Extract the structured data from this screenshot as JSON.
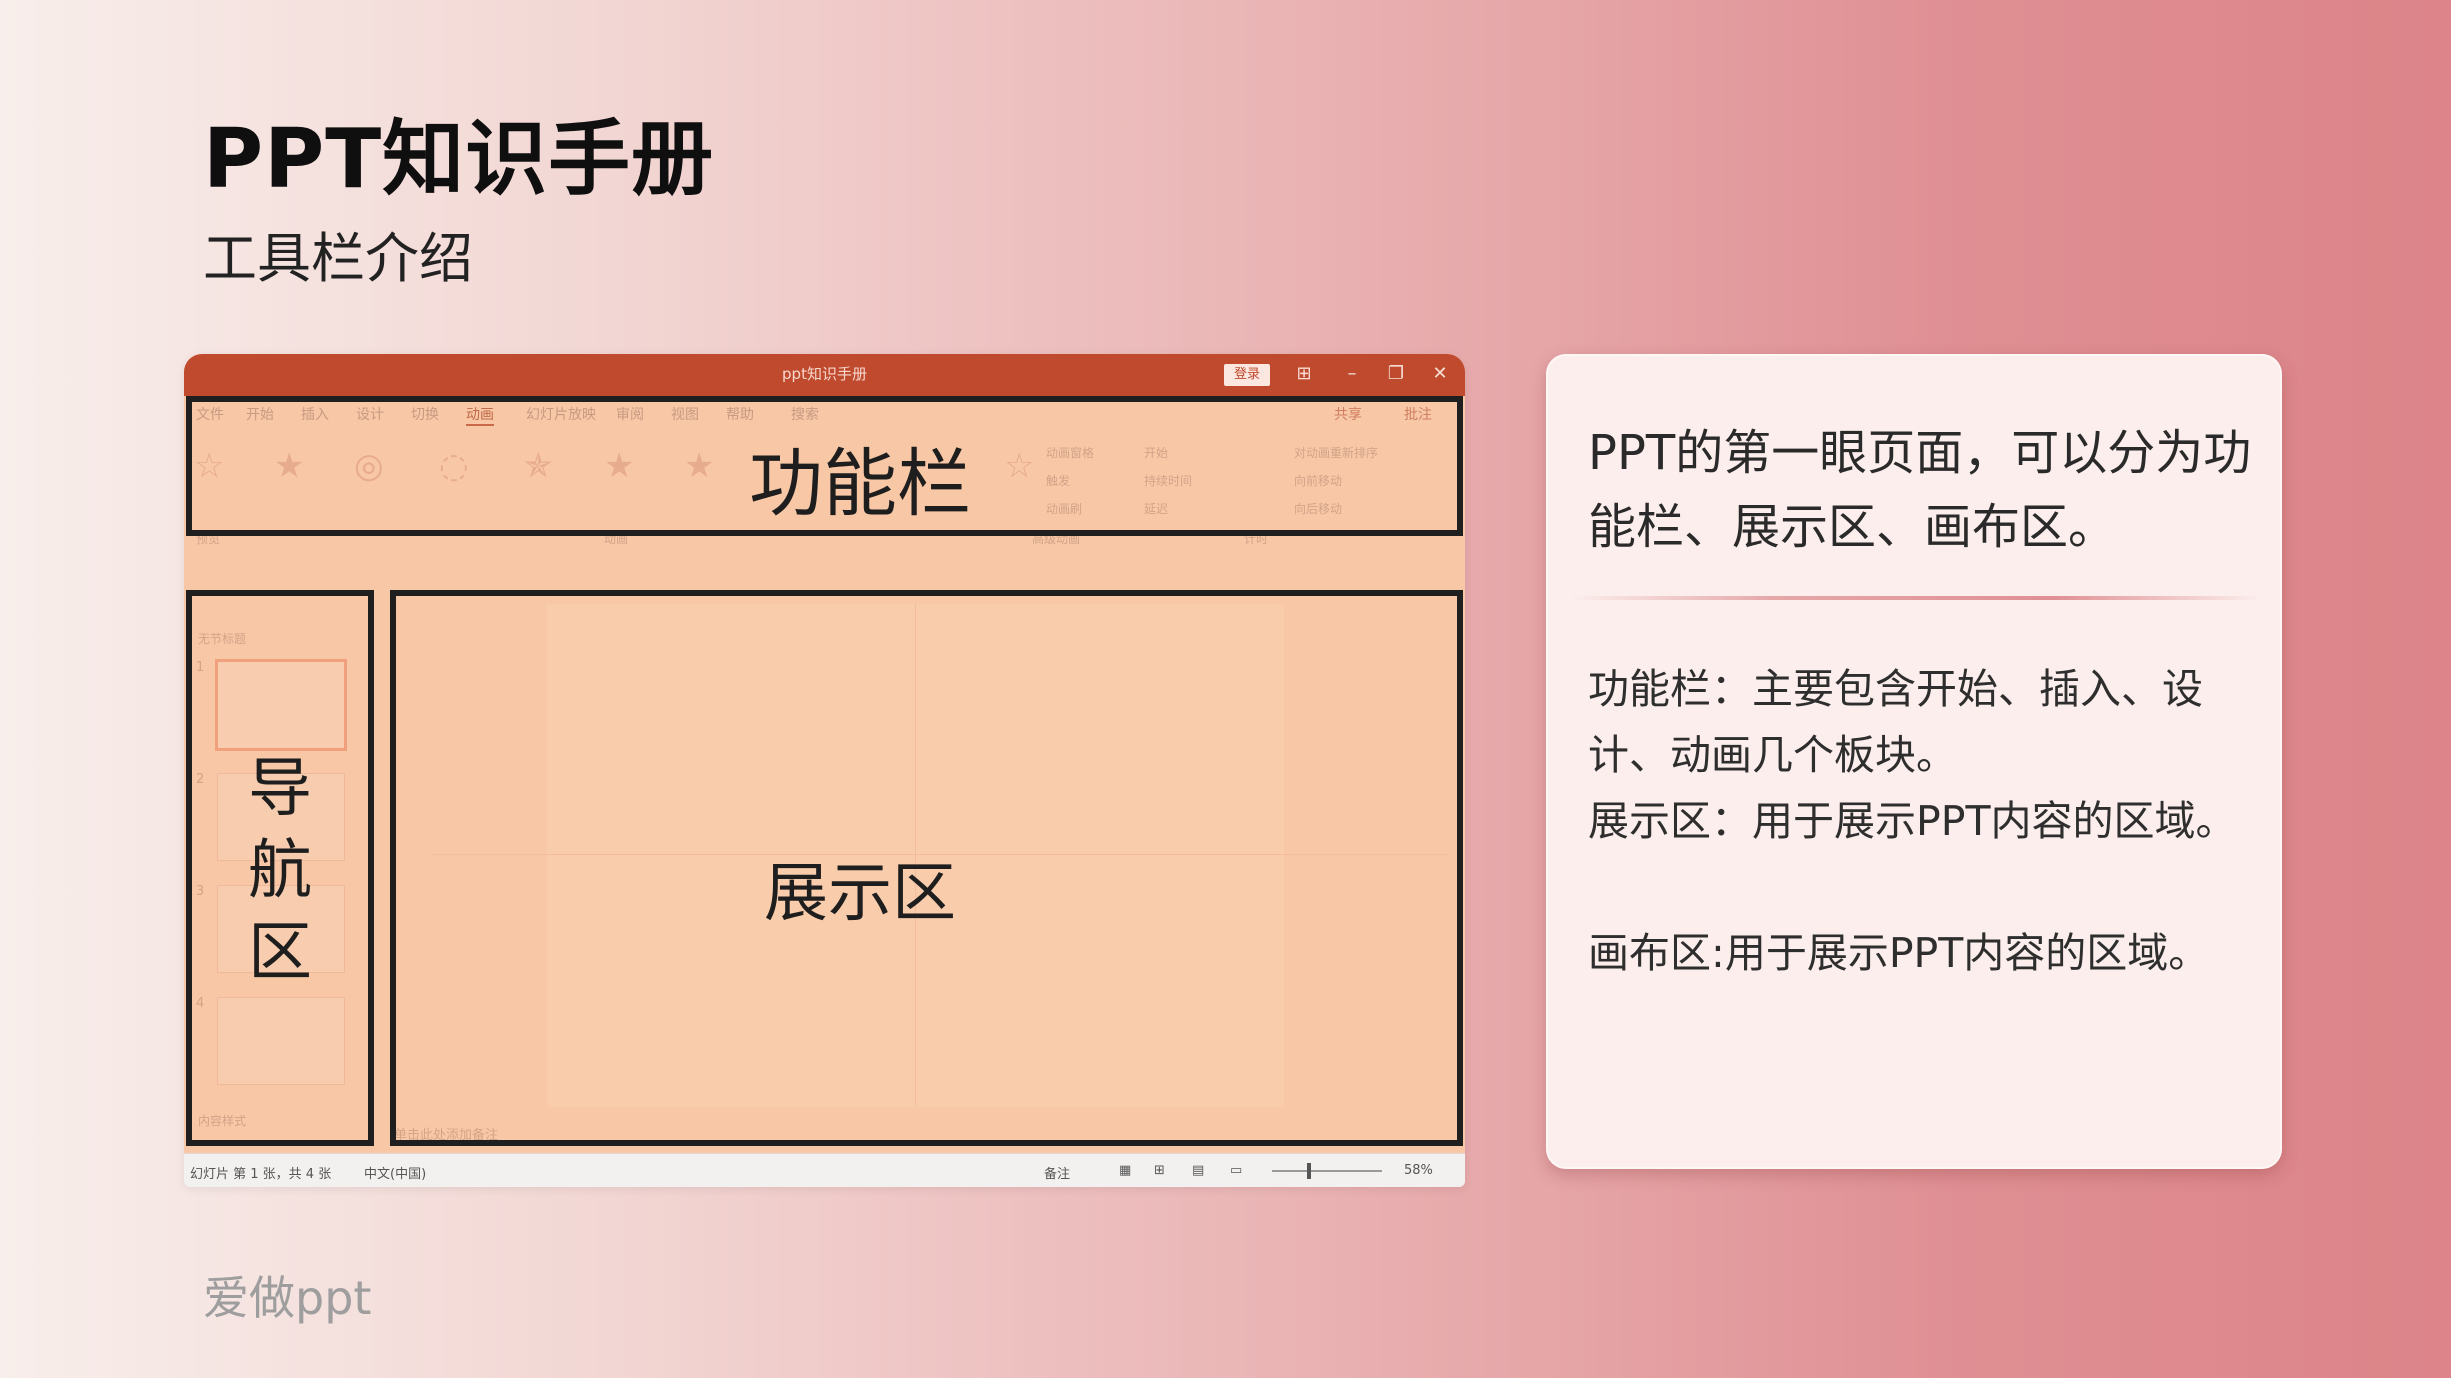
{
  "slide": {
    "title": "PPT知识手册",
    "subtitle": "工具栏介绍",
    "footer": "爱做ppt"
  },
  "screenshot": {
    "window_title": "ppt知识手册",
    "login_label": "登录",
    "tabs": [
      "文件",
      "开始",
      "插入",
      "设计",
      "切换",
      "动画",
      "幻灯片放映",
      "审阅",
      "视图",
      "帮助",
      "搜索"
    ],
    "active_tab": "动画",
    "share_label": "共享",
    "comment_label": "批注",
    "ribbon_groups": {
      "preview": "预览",
      "animation": "动画",
      "advanced": "高级动画",
      "timing": "计时"
    },
    "ribbon_items": {
      "animation_pane": "动画窗格",
      "trigger": "触发",
      "animation_painter": "动画刷",
      "start": "开始",
      "duration": "持续时间",
      "delay": "延迟",
      "reorder": "对动画重新排序",
      "move_earlier": "向前移动",
      "move_later": "向后移动"
    },
    "nav_section_1": "无节标题",
    "nav_section_2": "内容样式",
    "thumb_numbers": [
      "1",
      "2",
      "3",
      "4"
    ],
    "notes_hint": "单击此处添加备注",
    "labels": {
      "ribbon_region": "功能栏",
      "nav_region_chars": [
        "导",
        "航",
        "区"
      ],
      "display_region": "展示区"
    },
    "status": {
      "slide_count": "幻灯片 第 1 张，共 4 张",
      "language": "中文(中国)",
      "notes": "备注",
      "zoom": "58%"
    }
  },
  "card": {
    "lead": "PPT的第一眼页面，可以分为功能栏、展示区、画布区。",
    "p1": "功能栏：主要包含开始、插入、设计、动画几个板块。",
    "p2": "展示区：用于展示PPT内容的区域。",
    "p3": "画布区:用于展示PPT内容的区域。"
  },
  "colors": {
    "window_titlebar": "#c04a2d",
    "overlay": "#f7c7a6",
    "frame": "#1f1f1f",
    "card_bg": "#fbeeec"
  }
}
